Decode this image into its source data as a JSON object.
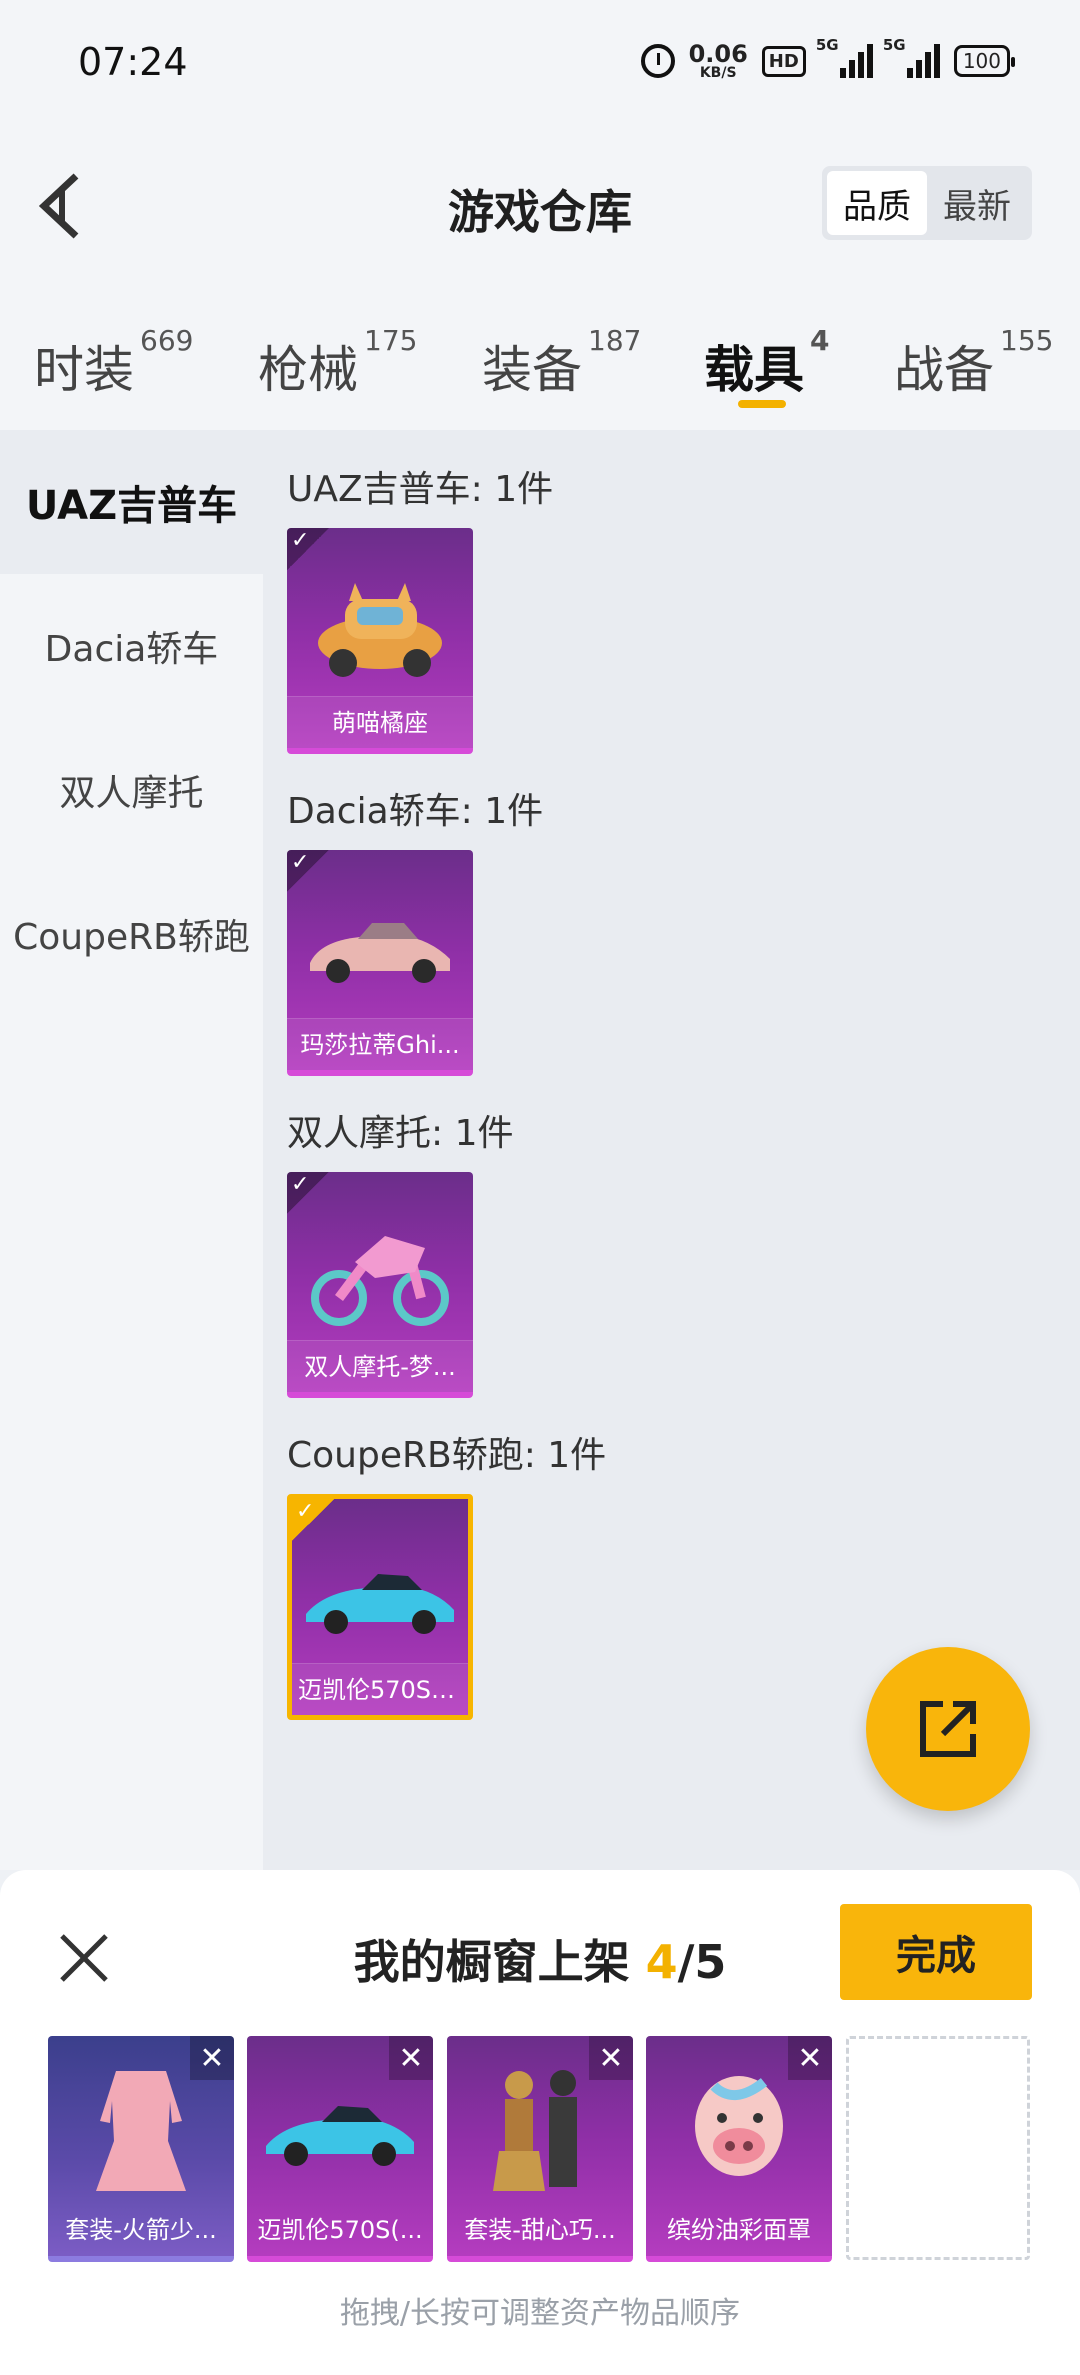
{
  "status_bar": {
    "time": "07:24",
    "net_speed": "0.06",
    "net_unit": "KB/S",
    "hd_label": "HD",
    "signal1": "5G",
    "signal2": "5G",
    "battery": "100"
  },
  "header": {
    "title": "游戏仓库",
    "sort_options": [
      "品质",
      "最新"
    ],
    "active_sort": "品质"
  },
  "tabs": [
    {
      "label": "时装",
      "count": "669"
    },
    {
      "label": "枪械",
      "count": "175"
    },
    {
      "label": "装备",
      "count": "187"
    },
    {
      "label": "载具",
      "count": "4"
    },
    {
      "label": "战备",
      "count": "155"
    }
  ],
  "active_tab": "载具",
  "sidebar": {
    "items": [
      "UAZ吉普车",
      "Dacia轿车",
      "双人摩托",
      "CoupeRB轿跑"
    ],
    "active": "UAZ吉普车"
  },
  "groups": [
    {
      "title": "UAZ吉普车: 1件",
      "item": "萌喵橘座",
      "selected": false
    },
    {
      "title": "Dacia轿车: 1件",
      "item": "玛莎拉蒂Ghi...",
      "selected": false
    },
    {
      "title": "双人摩托: 1件",
      "item": "双人摩托-梦...",
      "selected": false
    },
    {
      "title": "CoupeRB轿跑: 1件",
      "item": "迈凯伦570S(...",
      "selected": true
    }
  ],
  "panel": {
    "title_prefix": "我的橱窗上架 ",
    "count": "4",
    "total": "/5",
    "done_label": "完成",
    "shelf_items": [
      "套装-火箭少...",
      "迈凯伦570S(...",
      "套装-甜心巧...",
      "缤纷油彩面罩"
    ],
    "hint": "拖拽/长按可调整资产物品顺序"
  },
  "icons": {
    "back": "back-arrow-icon",
    "fab": "share-export-icon",
    "close": "close-icon",
    "check": "checkmark-icon",
    "remove": "remove-x-icon"
  },
  "colors": {
    "accent": "#f9b50b",
    "card_purple": "#8e2fa6",
    "card_blue": "#5a4aa8"
  }
}
